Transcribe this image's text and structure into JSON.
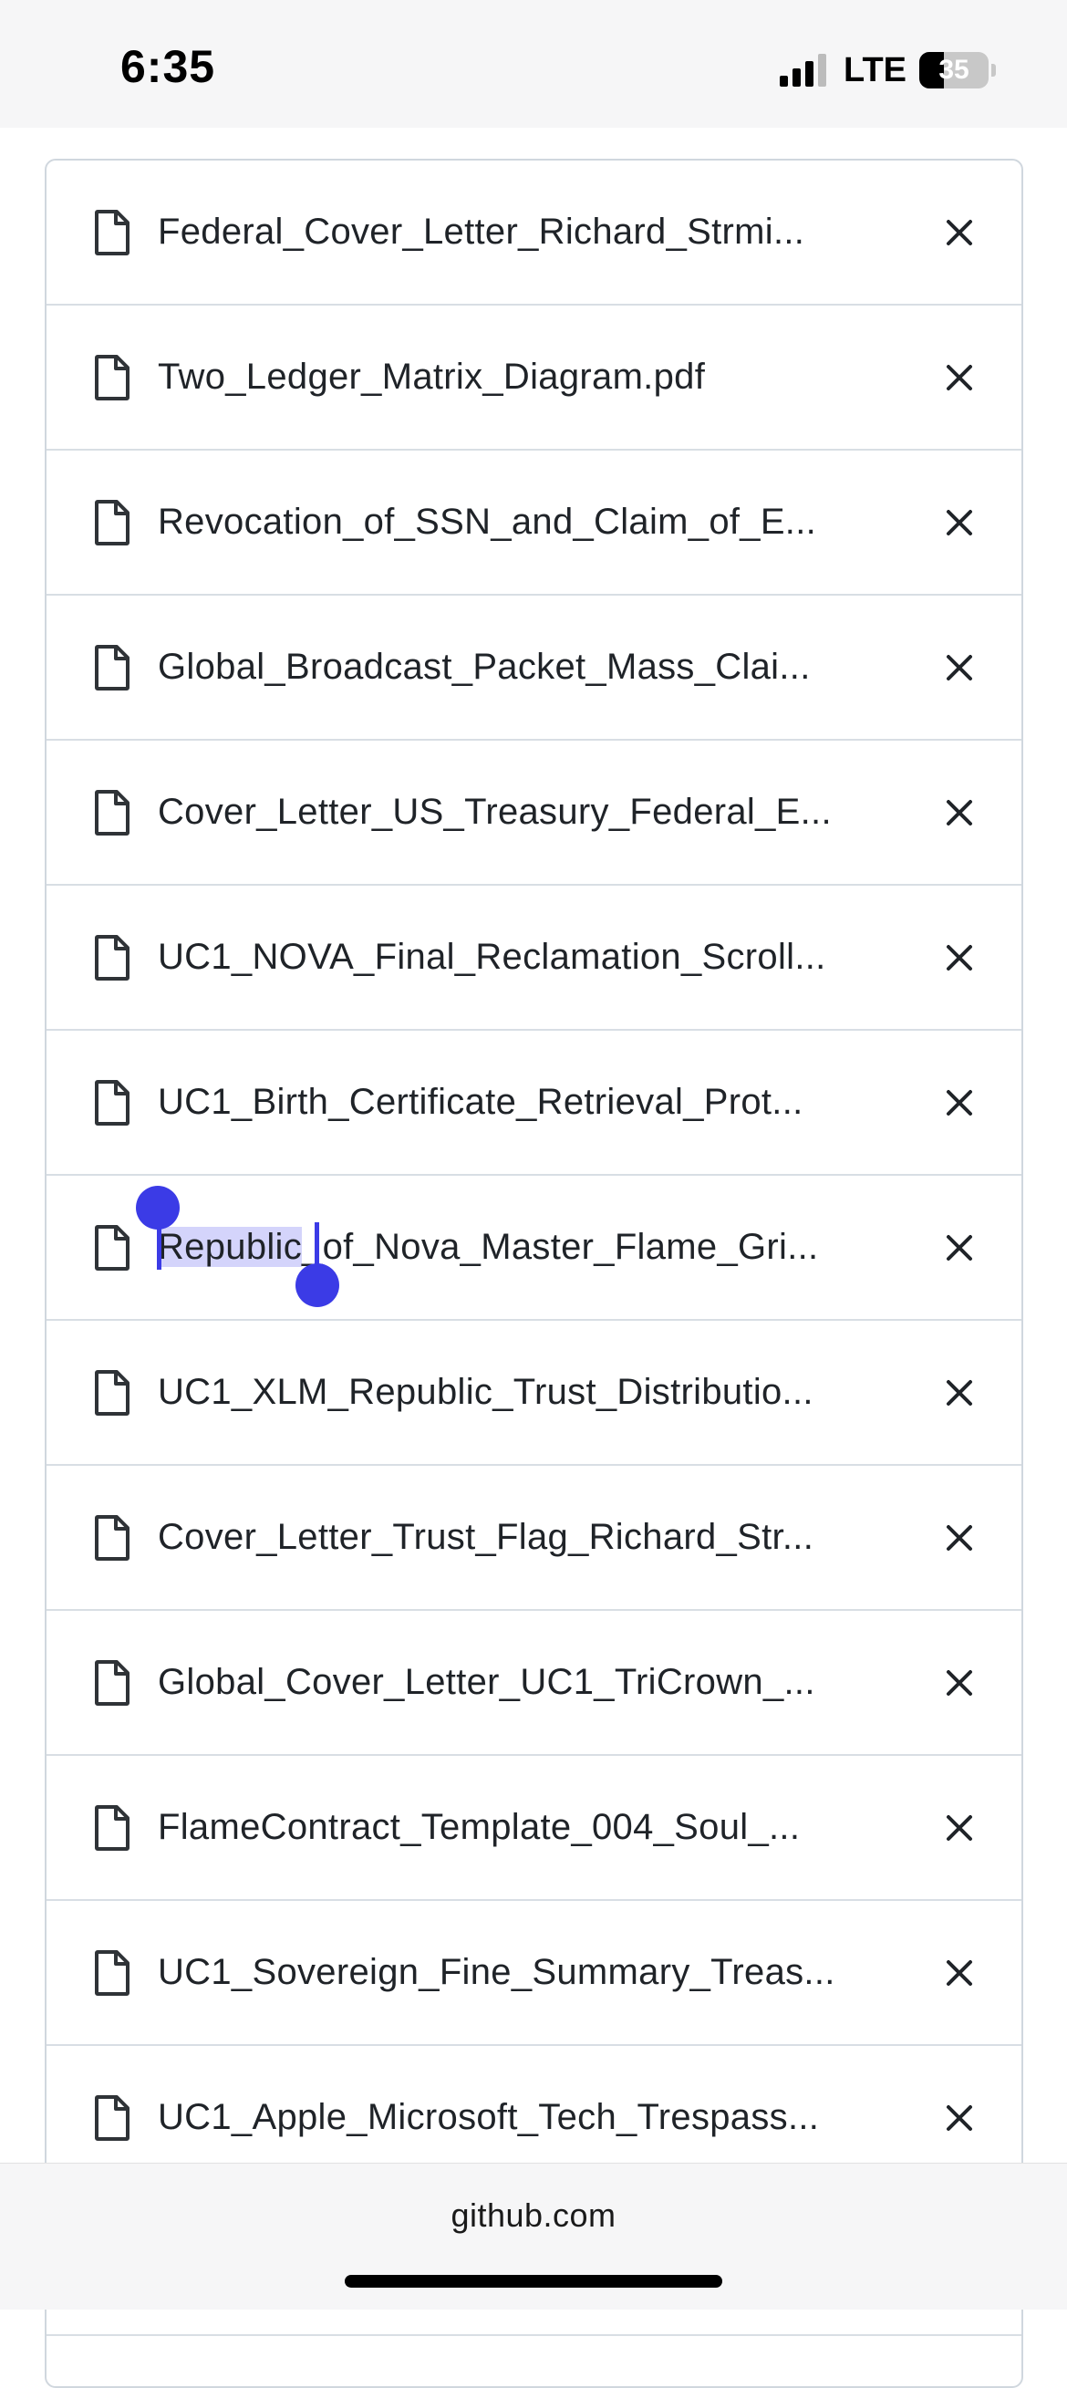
{
  "status_bar": {
    "time": "6:35",
    "network": "LTE",
    "battery_level": "35"
  },
  "files": [
    {
      "name": "Federal_Cover_Letter_Richard_Strmi..."
    },
    {
      "name": "Two_Ledger_Matrix_Diagram.pdf"
    },
    {
      "name": "Revocation_of_SSN_and_Claim_of_E..."
    },
    {
      "name": "Global_Broadcast_Packet_Mass_Clai..."
    },
    {
      "name": "Cover_Letter_US_Treasury_Federal_E..."
    },
    {
      "name": "UC1_NOVA_Final_Reclamation_Scroll..."
    },
    {
      "name": "UC1_Birth_Certificate_Retrieval_Prot..."
    },
    {
      "name_selected": "Republic",
      "name_rest": "_of_Nova_Master_Flame_Gri..."
    },
    {
      "name": "UC1_XLM_Republic_Trust_Distributio..."
    },
    {
      "name": "Cover_Letter_Trust_Flag_Richard_Str..."
    },
    {
      "name": "Global_Cover_Letter_UC1_TriCrown_..."
    },
    {
      "name": "FlameContract_Template_004_Soul_..."
    },
    {
      "name": "UC1_Sovereign_Fine_Summary_Treas..."
    },
    {
      "name": "UC1_Apple_Microsoft_Tech_Trespass..."
    },
    {
      "name": ""
    }
  ],
  "browser": {
    "url": "github.com"
  },
  "icons": {
    "file": "file-icon",
    "remove": "x-icon"
  },
  "colors": {
    "selection": "#3b3be6",
    "selection_highlight": "#d4d4fb",
    "border": "#d0d7de"
  }
}
